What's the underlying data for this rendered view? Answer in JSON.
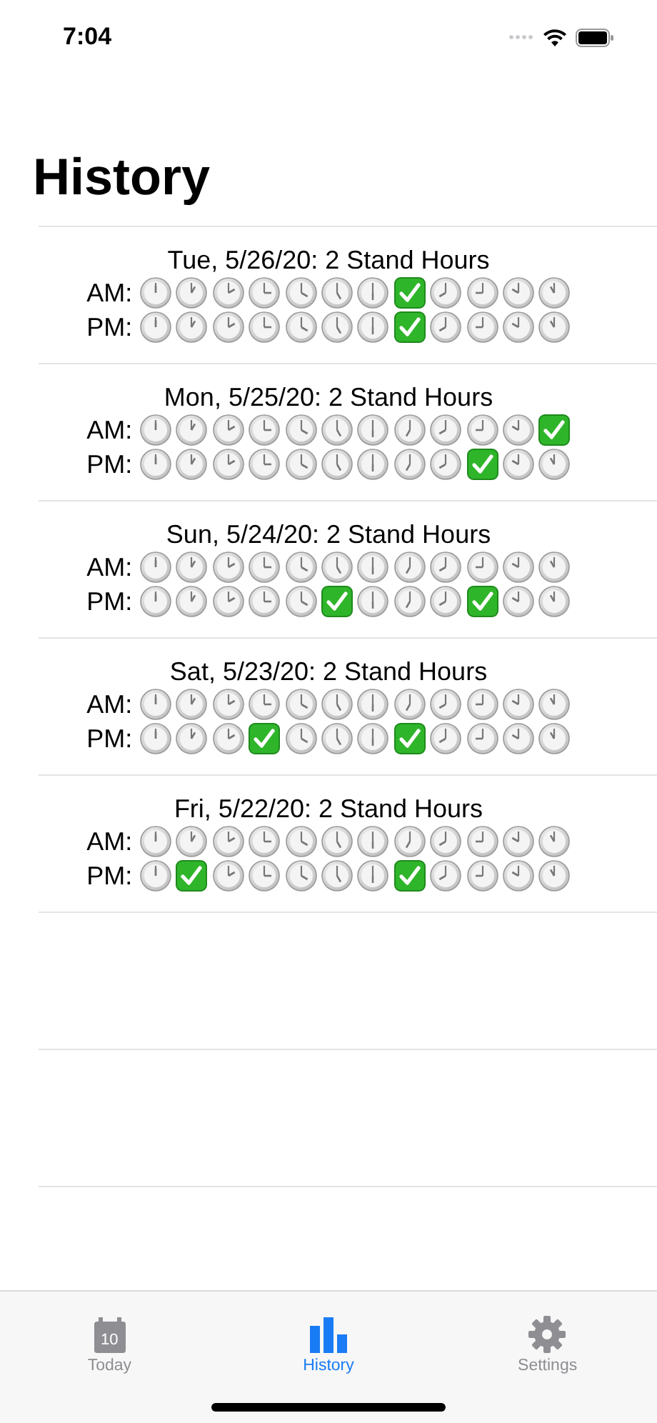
{
  "status_bar": {
    "time": "7:04"
  },
  "title": "History",
  "days": [
    {
      "heading": "Tue, 5/26/20: 2 Stand Hours",
      "rows": [
        {
          "label": "AM:",
          "hours": [
            {
              "checked": false
            },
            {
              "checked": false
            },
            {
              "checked": false
            },
            {
              "checked": false
            },
            {
              "checked": false
            },
            {
              "checked": false
            },
            {
              "checked": false
            },
            {
              "checked": true
            },
            {
              "checked": false
            },
            {
              "checked": false
            },
            {
              "checked": false
            },
            {
              "checked": false
            }
          ]
        },
        {
          "label": "PM:",
          "hours": [
            {
              "checked": false
            },
            {
              "checked": false
            },
            {
              "checked": false
            },
            {
              "checked": false
            },
            {
              "checked": false
            },
            {
              "checked": false
            },
            {
              "checked": false
            },
            {
              "checked": true
            },
            {
              "checked": false
            },
            {
              "checked": false
            },
            {
              "checked": false
            },
            {
              "checked": false
            }
          ]
        }
      ]
    },
    {
      "heading": "Mon, 5/25/20: 2 Stand Hours",
      "rows": [
        {
          "label": "AM:",
          "hours": [
            {
              "checked": false
            },
            {
              "checked": false
            },
            {
              "checked": false
            },
            {
              "checked": false
            },
            {
              "checked": false
            },
            {
              "checked": false
            },
            {
              "checked": false
            },
            {
              "checked": false
            },
            {
              "checked": false
            },
            {
              "checked": false
            },
            {
              "checked": false
            },
            {
              "checked": true
            }
          ]
        },
        {
          "label": "PM:",
          "hours": [
            {
              "checked": false
            },
            {
              "checked": false
            },
            {
              "checked": false
            },
            {
              "checked": false
            },
            {
              "checked": false
            },
            {
              "checked": false
            },
            {
              "checked": false
            },
            {
              "checked": false
            },
            {
              "checked": false
            },
            {
              "checked": true
            },
            {
              "checked": false
            },
            {
              "checked": false
            }
          ]
        }
      ]
    },
    {
      "heading": "Sun, 5/24/20: 2 Stand Hours",
      "rows": [
        {
          "label": "AM:",
          "hours": [
            {
              "checked": false
            },
            {
              "checked": false
            },
            {
              "checked": false
            },
            {
              "checked": false
            },
            {
              "checked": false
            },
            {
              "checked": false
            },
            {
              "checked": false
            },
            {
              "checked": false
            },
            {
              "checked": false
            },
            {
              "checked": false
            },
            {
              "checked": false
            },
            {
              "checked": false
            }
          ]
        },
        {
          "label": "PM:",
          "hours": [
            {
              "checked": false
            },
            {
              "checked": false
            },
            {
              "checked": false
            },
            {
              "checked": false
            },
            {
              "checked": false
            },
            {
              "checked": true
            },
            {
              "checked": false
            },
            {
              "checked": false
            },
            {
              "checked": false
            },
            {
              "checked": true
            },
            {
              "checked": false
            },
            {
              "checked": false
            }
          ]
        }
      ]
    },
    {
      "heading": "Sat, 5/23/20: 2 Stand Hours",
      "rows": [
        {
          "label": "AM:",
          "hours": [
            {
              "checked": false
            },
            {
              "checked": false
            },
            {
              "checked": false
            },
            {
              "checked": false
            },
            {
              "checked": false
            },
            {
              "checked": false
            },
            {
              "checked": false
            },
            {
              "checked": false
            },
            {
              "checked": false
            },
            {
              "checked": false
            },
            {
              "checked": false
            },
            {
              "checked": false
            }
          ]
        },
        {
          "label": "PM:",
          "hours": [
            {
              "checked": false
            },
            {
              "checked": false
            },
            {
              "checked": false
            },
            {
              "checked": true
            },
            {
              "checked": false
            },
            {
              "checked": false
            },
            {
              "checked": false
            },
            {
              "checked": true
            },
            {
              "checked": false
            },
            {
              "checked": false
            },
            {
              "checked": false
            },
            {
              "checked": false
            }
          ]
        }
      ]
    },
    {
      "heading": "Fri, 5/22/20: 2 Stand Hours",
      "rows": [
        {
          "label": "AM:",
          "hours": [
            {
              "checked": false
            },
            {
              "checked": false
            },
            {
              "checked": false
            },
            {
              "checked": false
            },
            {
              "checked": false
            },
            {
              "checked": false
            },
            {
              "checked": false
            },
            {
              "checked": false
            },
            {
              "checked": false
            },
            {
              "checked": false
            },
            {
              "checked": false
            },
            {
              "checked": false
            }
          ]
        },
        {
          "label": "PM:",
          "hours": [
            {
              "checked": false
            },
            {
              "checked": true
            },
            {
              "checked": false
            },
            {
              "checked": false
            },
            {
              "checked": false
            },
            {
              "checked": false
            },
            {
              "checked": false
            },
            {
              "checked": true
            },
            {
              "checked": false
            },
            {
              "checked": false
            },
            {
              "checked": false
            },
            {
              "checked": false
            }
          ]
        }
      ]
    }
  ],
  "tabs": [
    {
      "kind": "calendar",
      "label": "Today",
      "badge": "10",
      "selected": false
    },
    {
      "kind": "chart",
      "label": "History",
      "selected": true
    },
    {
      "kind": "gear",
      "label": "Settings",
      "selected": false
    }
  ]
}
